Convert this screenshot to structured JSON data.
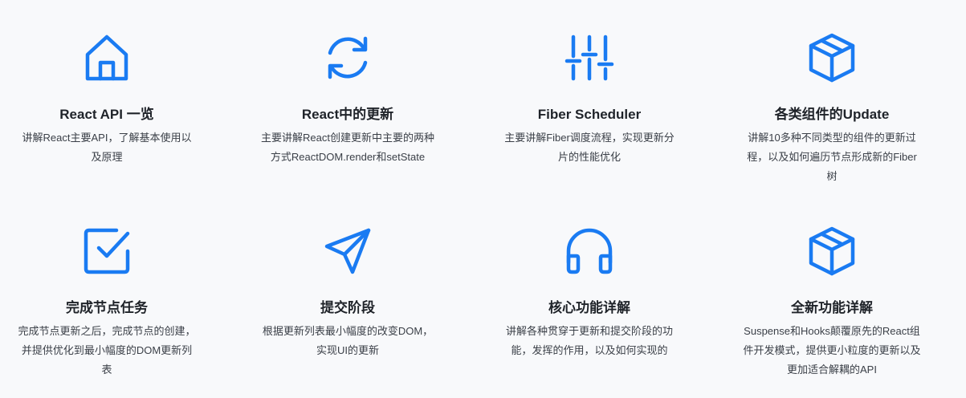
{
  "accent": "#1a7bf2",
  "cards": [
    {
      "icon": "home-icon",
      "title": "React API 一览",
      "desc": "讲解React主要API，了解基本使用以及原理"
    },
    {
      "icon": "refresh-icon",
      "title": "React中的更新",
      "desc": "主要讲解React创建更新中主要的两种方式ReactDOM.render和setState"
    },
    {
      "icon": "sliders-icon",
      "title": "Fiber Scheduler",
      "desc": "主要讲解Fiber调度流程，实现更新分片的性能优化"
    },
    {
      "icon": "box-icon",
      "title": "各类组件的Update",
      "desc": "讲解10多种不同类型的组件的更新过程，以及如何遍历节点形成新的Fiber树"
    },
    {
      "icon": "checkbox-icon",
      "title": "完成节点任务",
      "desc": "完成节点更新之后，完成节点的创建，并提供优化到最小幅度的DOM更新列表"
    },
    {
      "icon": "send-icon",
      "title": "提交阶段",
      "desc": "根据更新列表最小幅度的改变DOM，实现UI的更新"
    },
    {
      "icon": "headphones-icon",
      "title": "核心功能详解",
      "desc": "讲解各种贯穿于更新和提交阶段的功能，发挥的作用，以及如何实现的"
    },
    {
      "icon": "box-icon",
      "title": "全新功能详解",
      "desc": "Suspense和Hooks颠覆原先的React组件开发模式，提供更小粒度的更新以及更加适合解耦的API"
    }
  ]
}
